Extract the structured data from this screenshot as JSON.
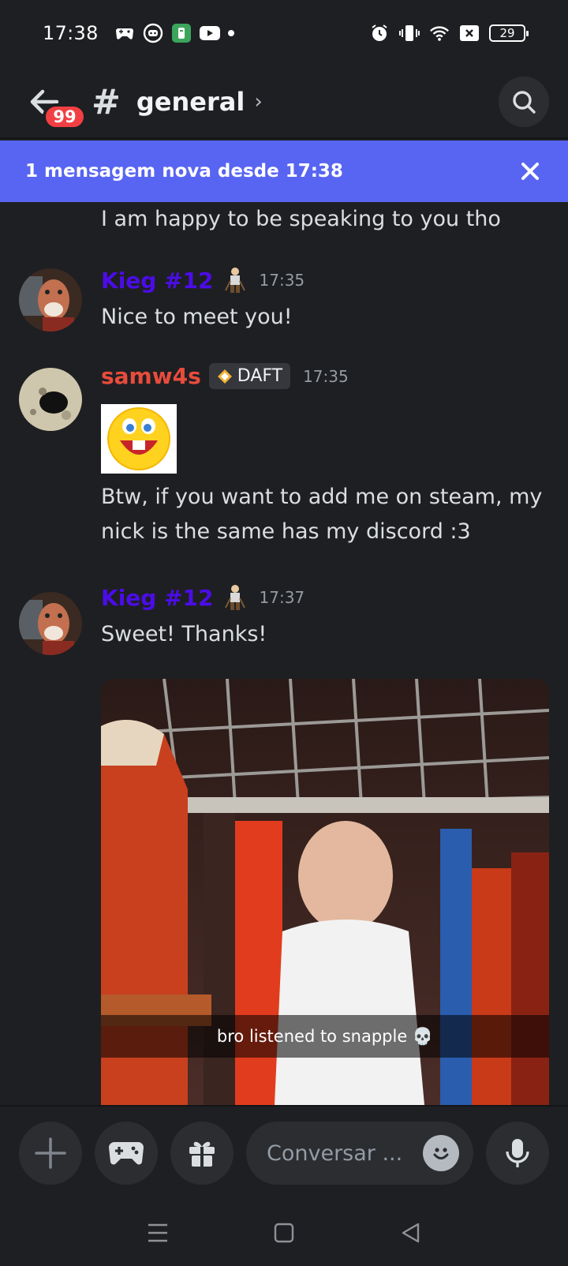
{
  "status_bar": {
    "time": "17:38",
    "battery": "29",
    "icons_left": [
      "gamepad-icon",
      "discord-icon",
      "app-icon",
      "youtube-icon",
      "dot-icon"
    ],
    "icons_right": [
      "alarm-icon",
      "vibrate-icon",
      "wifi-icon",
      "x-box-icon",
      "battery-icon"
    ]
  },
  "header": {
    "back_badge": "99",
    "hash": "#",
    "channel": "general",
    "chevron": "›"
  },
  "banner": {
    "text": "1 mensagem nova desde 17:38"
  },
  "messages": {
    "partial_line": "I am happy to be speaking to you tho",
    "m1": {
      "author": "Kieg #12",
      "time": "17:35",
      "text": "Nice to meet you!"
    },
    "m2": {
      "author": "samw4s",
      "tag": "DAFT",
      "time": "17:35",
      "text_line1": "Btw, if you want to add me on steam, my",
      "text_line2": "nick is the same has my discord :3"
    },
    "m3": {
      "author": "Kieg #12",
      "time": "17:37",
      "text": "Sweet! Thanks!",
      "video_caption": "bro listened to snapple 💀"
    }
  },
  "composer": {
    "placeholder": "Conversar ..."
  },
  "colors": {
    "background": "#1e1f22",
    "banner": "#5865f2",
    "badge": "#f23f43",
    "kieg_name": "#4b0ce8",
    "sam_name": "#e74c3c"
  }
}
